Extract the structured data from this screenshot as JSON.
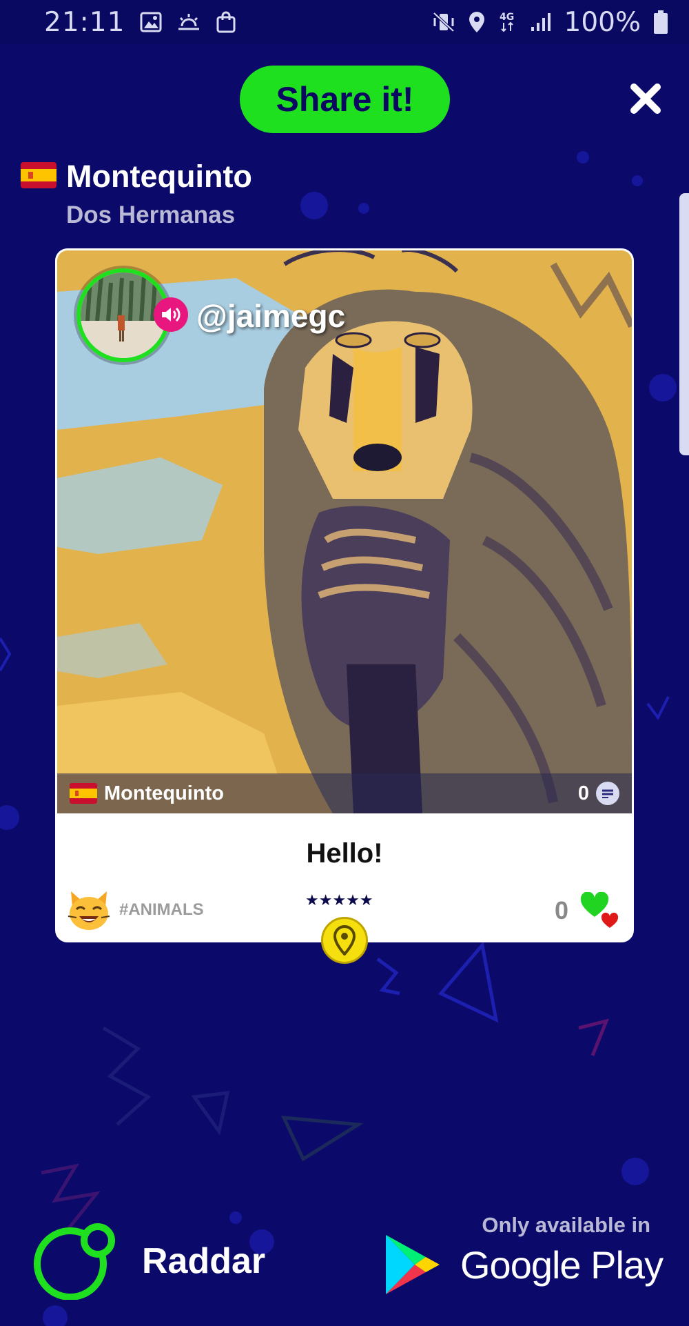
{
  "status_bar": {
    "time": "21:11",
    "battery": "100%",
    "network": "4G"
  },
  "header": {
    "share_label": "Share it!"
  },
  "location": {
    "title": "Montequinto",
    "subtitle": "Dos Hermanas",
    "flag": "spain-flag-icon"
  },
  "post": {
    "username": "@jaimegc",
    "footer_location": "Montequinto",
    "comment_count": "0",
    "caption": "Hello!",
    "category": "#ANIMALS",
    "category_icon": "cat-face-icon",
    "rating_stars": "★★★★★",
    "like_count": "0"
  },
  "branding": {
    "app_name": "Raddar",
    "store_note": "Only available in",
    "store_name": "Google Play"
  },
  "colors": {
    "background": "#0b0a6b",
    "accent_green": "#1ee01e",
    "audio_pink": "#e8177f",
    "pin_yellow": "#f5df0f"
  }
}
